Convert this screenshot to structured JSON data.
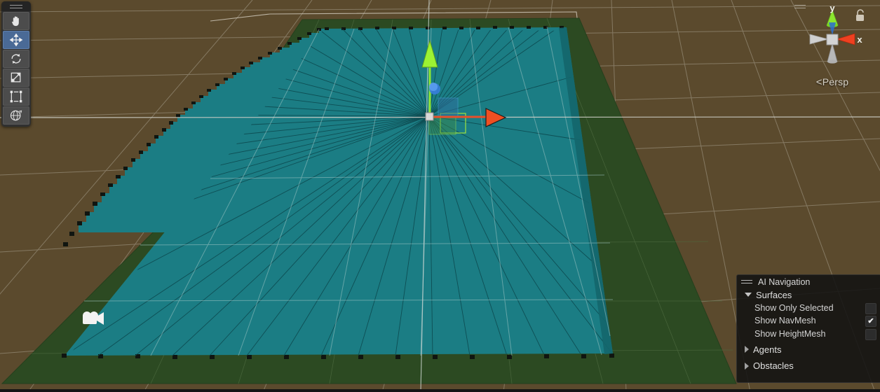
{
  "app": {
    "view_mode": "Persp",
    "axis_labels": {
      "x": "x",
      "y": "y"
    }
  },
  "toolbar": {
    "tools": [
      {
        "name": "hand-tool",
        "label": "Hand Tool",
        "icon": "hand-icon",
        "active": false
      },
      {
        "name": "move-tool",
        "label": "Move Tool",
        "icon": "move-icon",
        "active": true
      },
      {
        "name": "rotate-tool",
        "label": "Rotate Tool",
        "icon": "rotate-icon",
        "active": false
      },
      {
        "name": "scale-tool",
        "label": "Scale Tool",
        "icon": "scale-icon",
        "active": false
      },
      {
        "name": "rect-tool",
        "label": "Rect Tool",
        "icon": "rect-icon",
        "active": false
      },
      {
        "name": "transform-tool",
        "label": "Transform Tool",
        "icon": "transform-icon",
        "active": false
      }
    ]
  },
  "ai_navigation": {
    "title": "AI Navigation",
    "groups": [
      {
        "label": "Surfaces",
        "expanded": true,
        "options": [
          {
            "label": "Show Only Selected",
            "checked": false
          },
          {
            "label": "Show NavMesh",
            "checked": true
          },
          {
            "label": "Show HeightMesh",
            "checked": false
          }
        ]
      },
      {
        "label": "Agents",
        "expanded": false,
        "options": []
      },
      {
        "label": "Obstacles",
        "expanded": false,
        "options": []
      }
    ],
    "checkmark_glyph": "✔"
  },
  "scene": {
    "gizmo": {
      "x_axis_color": "#e8502a",
      "y_axis_color": "#8ee632",
      "z_axis_color": "#3a7fe0"
    },
    "colors": {
      "background": "#5b4a2d",
      "navmesh": "#1b7d84",
      "ground": "#2c4a22",
      "grid_line": "#a89a84",
      "selected_outline": "#8ee632"
    },
    "objects": [
      {
        "name": "navmesh-surface",
        "type": "navmesh"
      },
      {
        "name": "ground-plane",
        "type": "plane"
      },
      {
        "name": "scene-camera-gizmo",
        "type": "camera-icon"
      }
    ]
  }
}
